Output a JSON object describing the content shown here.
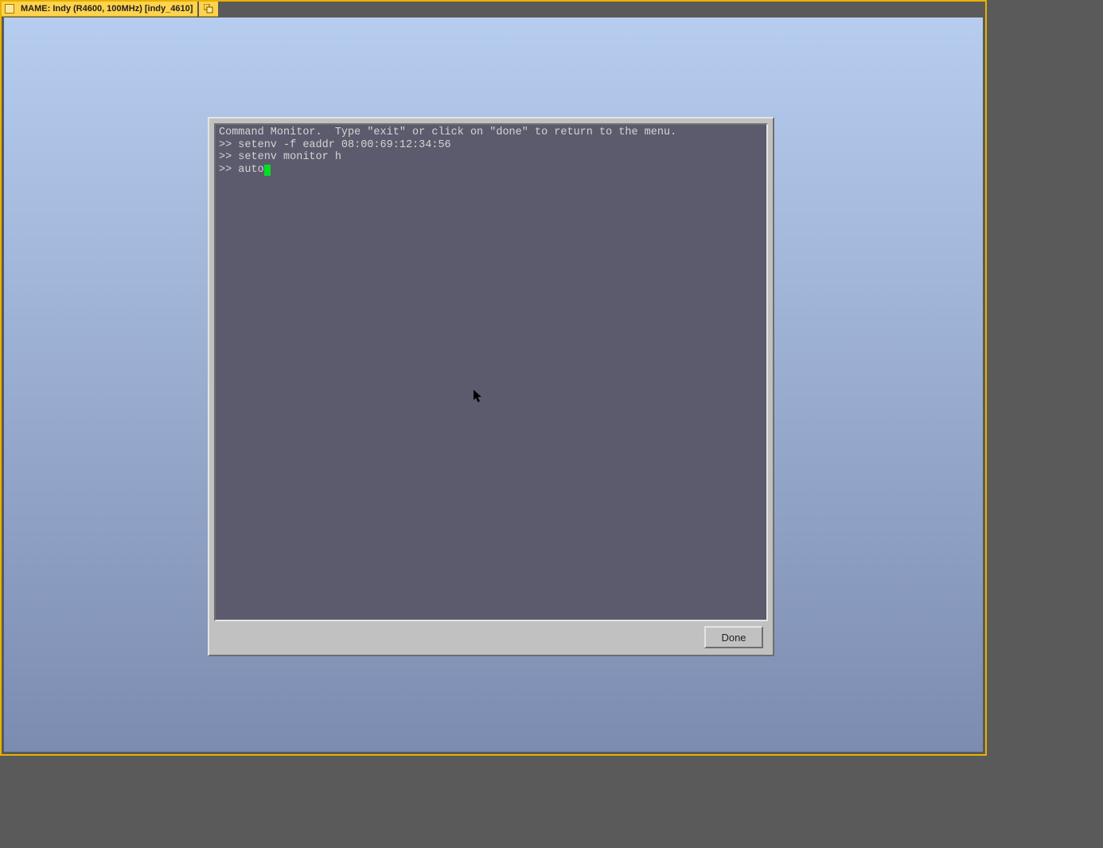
{
  "window": {
    "title": "MAME: Indy (R4600, 100MHz) [indy_4610]"
  },
  "console": {
    "header": "Command Monitor.  Type \"exit\" or click on \"done\" to return to the menu.",
    "prompt": ">>",
    "lines": [
      "setenv -f eaddr 08:00:69:12:34:56",
      "setenv monitor h"
    ],
    "current_input": "auto"
  },
  "buttons": {
    "done": "Done"
  }
}
